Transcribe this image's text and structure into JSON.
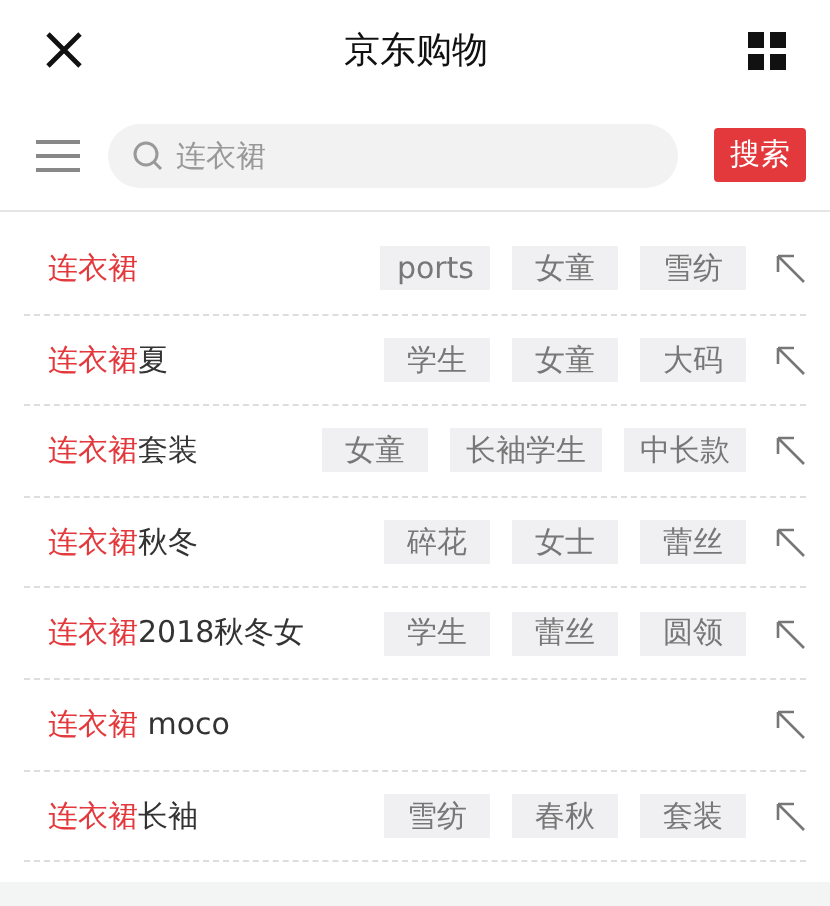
{
  "header": {
    "title": "京东购物"
  },
  "search": {
    "placeholder": "连衣裙",
    "button": "搜索"
  },
  "suggestions": [
    {
      "match": "连衣裙",
      "tags": [
        "ports",
        "女童",
        "雪纺"
      ]
    },
    {
      "match": "连衣裙",
      "rest": "夏",
      "tags": [
        "学生",
        "女童",
        "大码"
      ]
    },
    {
      "match": "连衣裙",
      "rest": "套装",
      "tags": [
        "女童",
        "长袖学生",
        "中长款"
      ]
    },
    {
      "match": "连衣裙",
      "rest": "秋冬",
      "tags": [
        "碎花",
        "女士",
        "蕾丝"
      ]
    },
    {
      "match": "连衣裙",
      "rest": "2018秋冬女",
      "tags": [
        "学生",
        "蕾丝",
        "圆领"
      ]
    },
    {
      "match": "连衣裙",
      "rest": " moco"
    },
    {
      "match": "连衣裙",
      "rest": "长袖",
      "tags": [
        "雪纺",
        "春秋",
        "套装"
      ]
    }
  ]
}
